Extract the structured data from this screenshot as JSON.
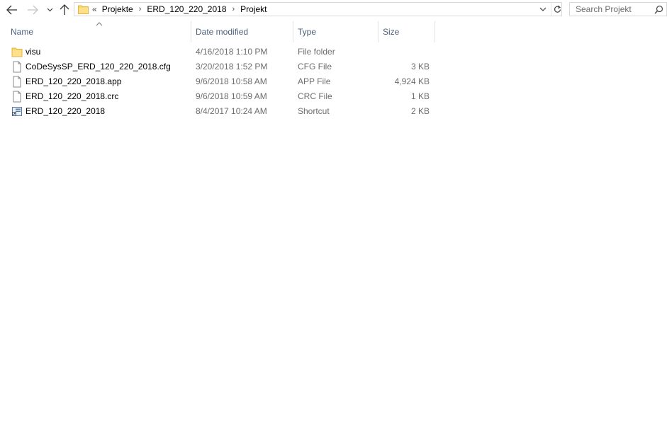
{
  "navigation": {
    "back_icon": "arrow-left-icon",
    "forward_icon": "arrow-right-icon",
    "recent_icon": "chevron-down-icon",
    "up_icon": "arrow-up-icon"
  },
  "address_bar": {
    "overflow_symbol": "«",
    "breadcrumbs": [
      "Projekte",
      "ERD_120_220_2018",
      "Projekt"
    ],
    "separator": "›"
  },
  "search": {
    "placeholder": "Search Projekt"
  },
  "columns": {
    "name": "Name",
    "date_modified": "Date modified",
    "type": "Type",
    "size": "Size"
  },
  "files": [
    {
      "name": "visu",
      "date": "4/16/2018 1:10 PM",
      "type": "File folder",
      "size": "",
      "icon": "folder-icon"
    },
    {
      "name": "CoDeSysSP_ERD_120_220_2018.cfg",
      "date": "3/20/2018 1:52 PM",
      "type": "CFG File",
      "size": "3 KB",
      "icon": "file-icon"
    },
    {
      "name": "ERD_120_220_2018.app",
      "date": "9/6/2018 10:58 AM",
      "type": "APP File",
      "size": "4,924 KB",
      "icon": "file-icon"
    },
    {
      "name": "ERD_120_220_2018.crc",
      "date": "9/6/2018 10:59 AM",
      "type": "CRC File",
      "size": "1 KB",
      "icon": "file-icon"
    },
    {
      "name": "ERD_120_220_2018",
      "date": "8/4/2017 10:24 AM",
      "type": "Shortcut",
      "size": "2 KB",
      "icon": "shortcut-icon"
    }
  ],
  "colors": {
    "folder_yellow": "#ffd866",
    "header_text": "#4c607a",
    "secondary_text": "#6d6d6d"
  }
}
